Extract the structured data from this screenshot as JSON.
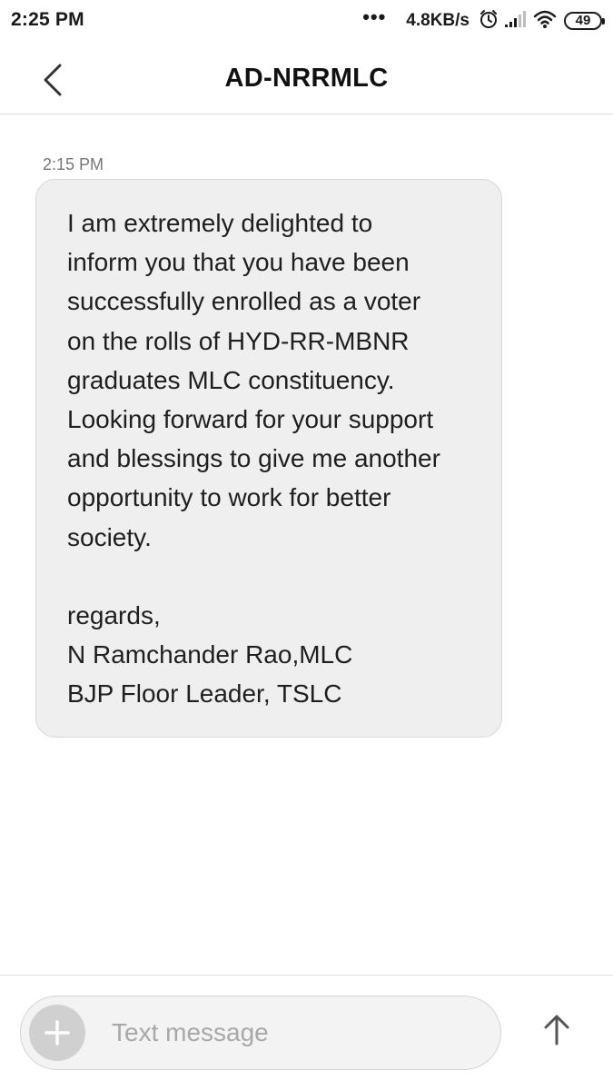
{
  "status_bar": {
    "time": "2:25 PM",
    "more_dots": "•••",
    "network_speed": "4.8KB/s",
    "battery_level": "49",
    "icons": [
      "alarm-icon",
      "signal-icon",
      "wifi-icon",
      "battery-icon"
    ]
  },
  "header": {
    "title": "AD-NRRMLC",
    "back_icon": "chevron-left-icon"
  },
  "conversation": {
    "messages": [
      {
        "time": "2:15 PM",
        "text": "I am extremely delighted to\ninform you that you have been\nsuccessfully enrolled as a voter\non the rolls of HYD-RR-MBNR\ngraduates MLC constituency.\nLooking forward for your support\nand blessings to give me another\nopportunity to work for better\nsociety.\n\nregards,\nN Ramchander Rao,MLC\nBJP Floor Leader, TSLC"
      }
    ]
  },
  "composer": {
    "placeholder": "Text message",
    "value": "",
    "add_icon": "plus-icon",
    "send_icon": "arrow-up-icon"
  },
  "colors": {
    "bubble_background": "#efefef",
    "add_button": "#d0d0d0",
    "placeholder": "#a8a8a8",
    "timestamp": "#777777"
  }
}
